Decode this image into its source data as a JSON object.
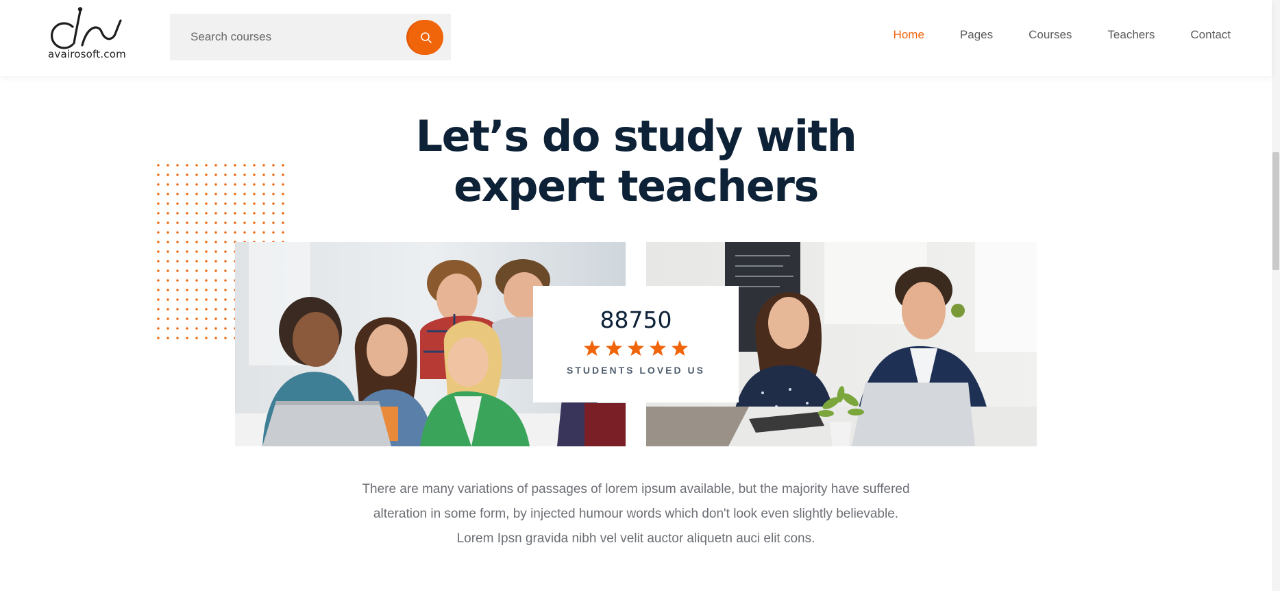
{
  "header": {
    "logo_text": "avairosoft.com",
    "search": {
      "placeholder": "Search courses"
    },
    "nav": [
      "Home",
      "Pages",
      "Courses",
      "Teachers",
      "Contact"
    ],
    "active_nav": "Home"
  },
  "hero": {
    "title_line1": "Let’s do study with",
    "title_line2": "expert teachers",
    "stat": {
      "number": "88750",
      "rating_stars": 5,
      "label": "STUDENTS LOVED US"
    },
    "paragraph": "There are many variations of passages of lorem ipsum available, but the majority have suffered alteration in some form, by injected humour words which don't look even slightly believable. Lorem Ipsn gravida nibh vel velit auctor aliquetn auci elit cons."
  },
  "colors": {
    "accent": "#f0640a",
    "heading": "#0d2137",
    "body_text": "#6b6e74"
  },
  "icons": [
    "logo-mark",
    "search-icon",
    "star-icon"
  ]
}
